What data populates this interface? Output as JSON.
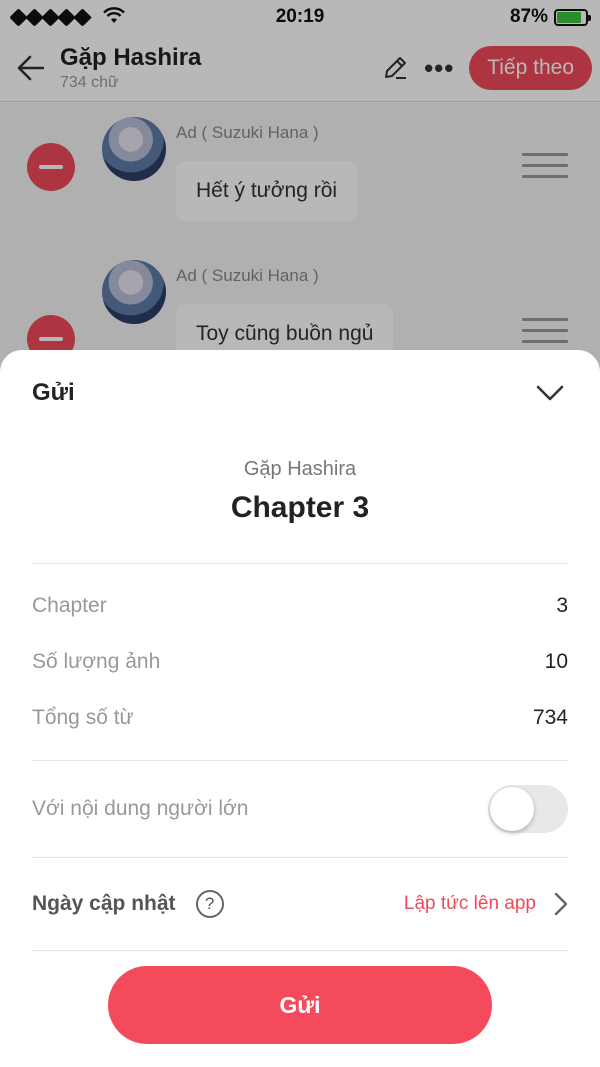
{
  "status_bar": {
    "time": "20:19",
    "battery": "87%",
    "battery_level": 0.87
  },
  "header": {
    "title": "Gặp Hashira",
    "subtitle": "734 chữ",
    "next_label": "Tiếp theo"
  },
  "messages": [
    {
      "author": "Ad ( Suzuki Hana )",
      "text": "Hết ý tưởng rồi"
    },
    {
      "author": "Ad ( Suzuki Hana )",
      "text": "Toy cũng buồn ngủ"
    }
  ],
  "sheet": {
    "title": "Gửi",
    "story_name": "Gặp Hashira",
    "chapter_title": "Chapter 3",
    "info": [
      {
        "label": "Chapter",
        "value": "3"
      },
      {
        "label": "Số lượng ảnh",
        "value": "10"
      },
      {
        "label": "Tổng số từ",
        "value": "734"
      }
    ],
    "adult_label": "Với nội dung người lớn",
    "adult_enabled": false,
    "date_label": "Ngày cập nhật",
    "help_glyph": "?",
    "date_value": "Lập tức lên app",
    "submit_label": "Gửi"
  },
  "colors": {
    "accent": "#ef4a5a",
    "battery": "#3bc43b"
  }
}
